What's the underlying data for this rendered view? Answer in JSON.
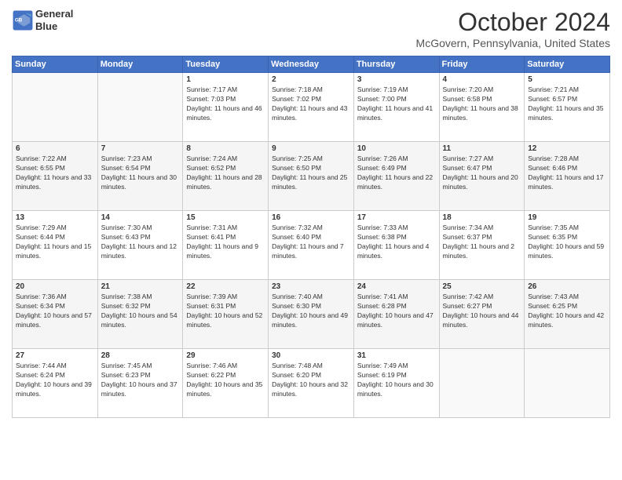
{
  "header": {
    "logo_line1": "General",
    "logo_line2": "Blue",
    "month": "October 2024",
    "location": "McGovern, Pennsylvania, United States"
  },
  "days_of_week": [
    "Sunday",
    "Monday",
    "Tuesday",
    "Wednesday",
    "Thursday",
    "Friday",
    "Saturday"
  ],
  "weeks": [
    [
      {
        "day": "",
        "sunrise": "",
        "sunset": "",
        "daylight": ""
      },
      {
        "day": "",
        "sunrise": "",
        "sunset": "",
        "daylight": ""
      },
      {
        "day": "1",
        "sunrise": "Sunrise: 7:17 AM",
        "sunset": "Sunset: 7:03 PM",
        "daylight": "Daylight: 11 hours and 46 minutes."
      },
      {
        "day": "2",
        "sunrise": "Sunrise: 7:18 AM",
        "sunset": "Sunset: 7:02 PM",
        "daylight": "Daylight: 11 hours and 43 minutes."
      },
      {
        "day": "3",
        "sunrise": "Sunrise: 7:19 AM",
        "sunset": "Sunset: 7:00 PM",
        "daylight": "Daylight: 11 hours and 41 minutes."
      },
      {
        "day": "4",
        "sunrise": "Sunrise: 7:20 AM",
        "sunset": "Sunset: 6:58 PM",
        "daylight": "Daylight: 11 hours and 38 minutes."
      },
      {
        "day": "5",
        "sunrise": "Sunrise: 7:21 AM",
        "sunset": "Sunset: 6:57 PM",
        "daylight": "Daylight: 11 hours and 35 minutes."
      }
    ],
    [
      {
        "day": "6",
        "sunrise": "Sunrise: 7:22 AM",
        "sunset": "Sunset: 6:55 PM",
        "daylight": "Daylight: 11 hours and 33 minutes."
      },
      {
        "day": "7",
        "sunrise": "Sunrise: 7:23 AM",
        "sunset": "Sunset: 6:54 PM",
        "daylight": "Daylight: 11 hours and 30 minutes."
      },
      {
        "day": "8",
        "sunrise": "Sunrise: 7:24 AM",
        "sunset": "Sunset: 6:52 PM",
        "daylight": "Daylight: 11 hours and 28 minutes."
      },
      {
        "day": "9",
        "sunrise": "Sunrise: 7:25 AM",
        "sunset": "Sunset: 6:50 PM",
        "daylight": "Daylight: 11 hours and 25 minutes."
      },
      {
        "day": "10",
        "sunrise": "Sunrise: 7:26 AM",
        "sunset": "Sunset: 6:49 PM",
        "daylight": "Daylight: 11 hours and 22 minutes."
      },
      {
        "day": "11",
        "sunrise": "Sunrise: 7:27 AM",
        "sunset": "Sunset: 6:47 PM",
        "daylight": "Daylight: 11 hours and 20 minutes."
      },
      {
        "day": "12",
        "sunrise": "Sunrise: 7:28 AM",
        "sunset": "Sunset: 6:46 PM",
        "daylight": "Daylight: 11 hours and 17 minutes."
      }
    ],
    [
      {
        "day": "13",
        "sunrise": "Sunrise: 7:29 AM",
        "sunset": "Sunset: 6:44 PM",
        "daylight": "Daylight: 11 hours and 15 minutes."
      },
      {
        "day": "14",
        "sunrise": "Sunrise: 7:30 AM",
        "sunset": "Sunset: 6:43 PM",
        "daylight": "Daylight: 11 hours and 12 minutes."
      },
      {
        "day": "15",
        "sunrise": "Sunrise: 7:31 AM",
        "sunset": "Sunset: 6:41 PM",
        "daylight": "Daylight: 11 hours and 9 minutes."
      },
      {
        "day": "16",
        "sunrise": "Sunrise: 7:32 AM",
        "sunset": "Sunset: 6:40 PM",
        "daylight": "Daylight: 11 hours and 7 minutes."
      },
      {
        "day": "17",
        "sunrise": "Sunrise: 7:33 AM",
        "sunset": "Sunset: 6:38 PM",
        "daylight": "Daylight: 11 hours and 4 minutes."
      },
      {
        "day": "18",
        "sunrise": "Sunrise: 7:34 AM",
        "sunset": "Sunset: 6:37 PM",
        "daylight": "Daylight: 11 hours and 2 minutes."
      },
      {
        "day": "19",
        "sunrise": "Sunrise: 7:35 AM",
        "sunset": "Sunset: 6:35 PM",
        "daylight": "Daylight: 10 hours and 59 minutes."
      }
    ],
    [
      {
        "day": "20",
        "sunrise": "Sunrise: 7:36 AM",
        "sunset": "Sunset: 6:34 PM",
        "daylight": "Daylight: 10 hours and 57 minutes."
      },
      {
        "day": "21",
        "sunrise": "Sunrise: 7:38 AM",
        "sunset": "Sunset: 6:32 PM",
        "daylight": "Daylight: 10 hours and 54 minutes."
      },
      {
        "day": "22",
        "sunrise": "Sunrise: 7:39 AM",
        "sunset": "Sunset: 6:31 PM",
        "daylight": "Daylight: 10 hours and 52 minutes."
      },
      {
        "day": "23",
        "sunrise": "Sunrise: 7:40 AM",
        "sunset": "Sunset: 6:30 PM",
        "daylight": "Daylight: 10 hours and 49 minutes."
      },
      {
        "day": "24",
        "sunrise": "Sunrise: 7:41 AM",
        "sunset": "Sunset: 6:28 PM",
        "daylight": "Daylight: 10 hours and 47 minutes."
      },
      {
        "day": "25",
        "sunrise": "Sunrise: 7:42 AM",
        "sunset": "Sunset: 6:27 PM",
        "daylight": "Daylight: 10 hours and 44 minutes."
      },
      {
        "day": "26",
        "sunrise": "Sunrise: 7:43 AM",
        "sunset": "Sunset: 6:25 PM",
        "daylight": "Daylight: 10 hours and 42 minutes."
      }
    ],
    [
      {
        "day": "27",
        "sunrise": "Sunrise: 7:44 AM",
        "sunset": "Sunset: 6:24 PM",
        "daylight": "Daylight: 10 hours and 39 minutes."
      },
      {
        "day": "28",
        "sunrise": "Sunrise: 7:45 AM",
        "sunset": "Sunset: 6:23 PM",
        "daylight": "Daylight: 10 hours and 37 minutes."
      },
      {
        "day": "29",
        "sunrise": "Sunrise: 7:46 AM",
        "sunset": "Sunset: 6:22 PM",
        "daylight": "Daylight: 10 hours and 35 minutes."
      },
      {
        "day": "30",
        "sunrise": "Sunrise: 7:48 AM",
        "sunset": "Sunset: 6:20 PM",
        "daylight": "Daylight: 10 hours and 32 minutes."
      },
      {
        "day": "31",
        "sunrise": "Sunrise: 7:49 AM",
        "sunset": "Sunset: 6:19 PM",
        "daylight": "Daylight: 10 hours and 30 minutes."
      },
      {
        "day": "",
        "sunrise": "",
        "sunset": "",
        "daylight": ""
      },
      {
        "day": "",
        "sunrise": "",
        "sunset": "",
        "daylight": ""
      }
    ]
  ]
}
